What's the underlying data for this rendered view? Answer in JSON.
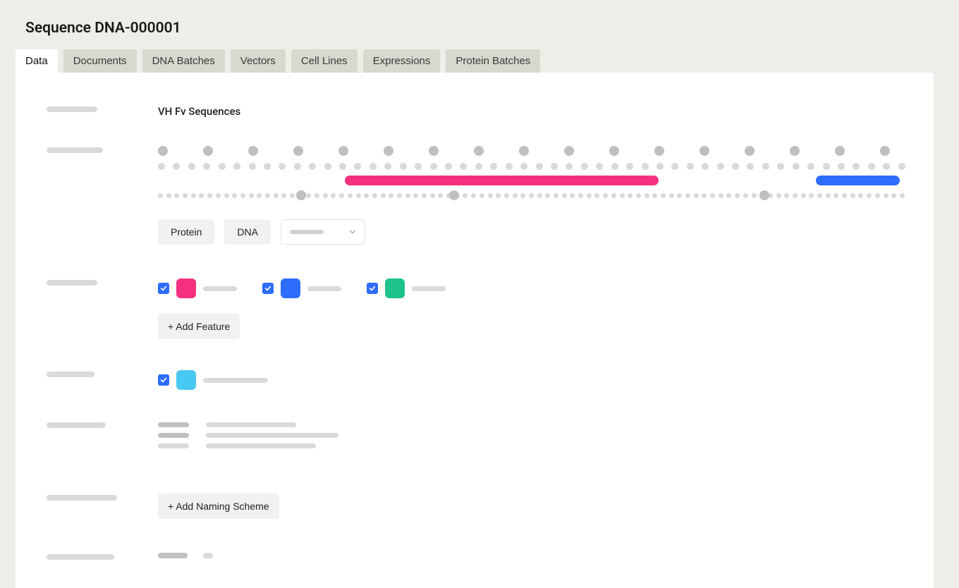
{
  "page_title": "Sequence DNA-000001",
  "tabs": [
    {
      "label": "Data",
      "active": true
    },
    {
      "label": "Documents",
      "active": false
    },
    {
      "label": "DNA Batches",
      "active": false
    },
    {
      "label": "Vectors",
      "active": false
    },
    {
      "label": "Cell Lines",
      "active": false
    },
    {
      "label": "Expressions",
      "active": false
    },
    {
      "label": "Protein Batches",
      "active": false
    }
  ],
  "section_heading": "VH Fv Sequences",
  "toggle_buttons": {
    "protein": "Protein",
    "dna": "DNA"
  },
  "features": [
    {
      "color": "pink",
      "checked": true
    },
    {
      "color": "blue",
      "checked": true
    },
    {
      "color": "green",
      "checked": true
    }
  ],
  "add_feature_label": "+ Add Feature",
  "option_row": {
    "color": "cyan",
    "checked": true
  },
  "add_naming_scheme_label": "+ Add Naming Scheme",
  "feature_tracks": [
    {
      "color": "#f5317f",
      "left_pct": 25,
      "width_pct": 42
    },
    {
      "color": "#2d6cff",
      "left_pct": 88,
      "width_pct": 11.2
    }
  ]
}
